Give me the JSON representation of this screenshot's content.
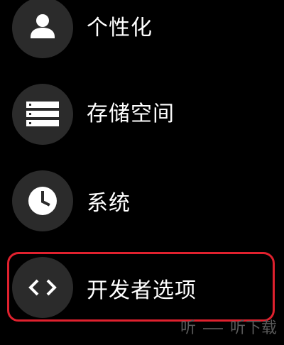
{
  "settings": {
    "items": [
      {
        "label": "个性化",
        "icon": "person-icon"
      },
      {
        "label": "存储空间",
        "icon": "storage-icon"
      },
      {
        "label": "系统",
        "icon": "clock-icon"
      },
      {
        "label": "开发者选项",
        "icon": "code-brackets-icon",
        "highlighted": true
      }
    ]
  },
  "watermark": {
    "text": "听下载",
    "glyph": "听"
  },
  "colors": {
    "background": "#000000",
    "icon_circle": "#2b2b2b",
    "text": "#ffffff",
    "highlight": "#e0212e"
  }
}
